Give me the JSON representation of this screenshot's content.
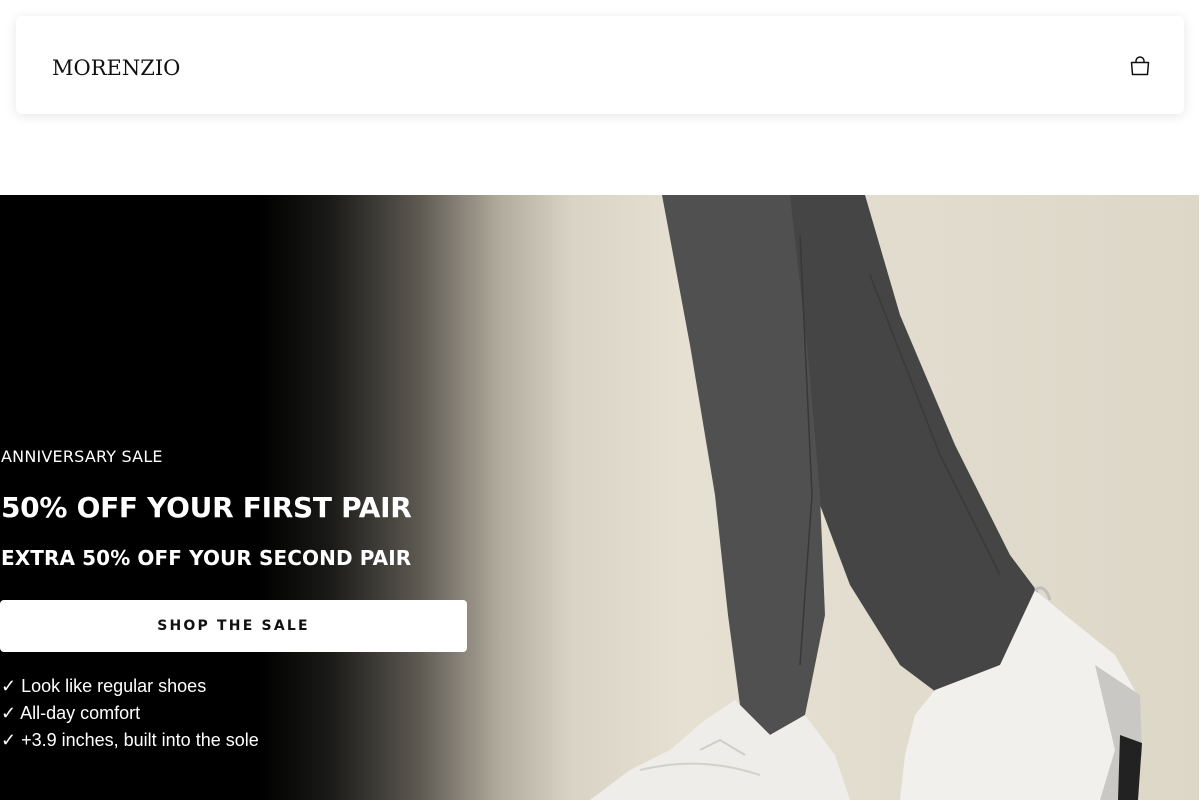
{
  "header": {
    "brand": "MORENZIO",
    "cart_icon": "shopping-bag-icon"
  },
  "hero": {
    "eyebrow": "ANNIVERSARY SALE",
    "headline": "50% OFF YOUR FIRST PAIR",
    "subheadline": "EXTRA 50% OFF YOUR SECOND PAIR",
    "cta_label": "SHOP THE SALE",
    "benefits": [
      "✓ Look like regular shoes",
      "✓ All-day comfort",
      "✓ +3.9 inches, built into the sole"
    ]
  },
  "colors": {
    "hero_dark": "#000000",
    "hero_light": "#e5e0d2",
    "cta_background": "#ffffff",
    "text_light": "#ffffff",
    "text_dark": "#111111"
  }
}
